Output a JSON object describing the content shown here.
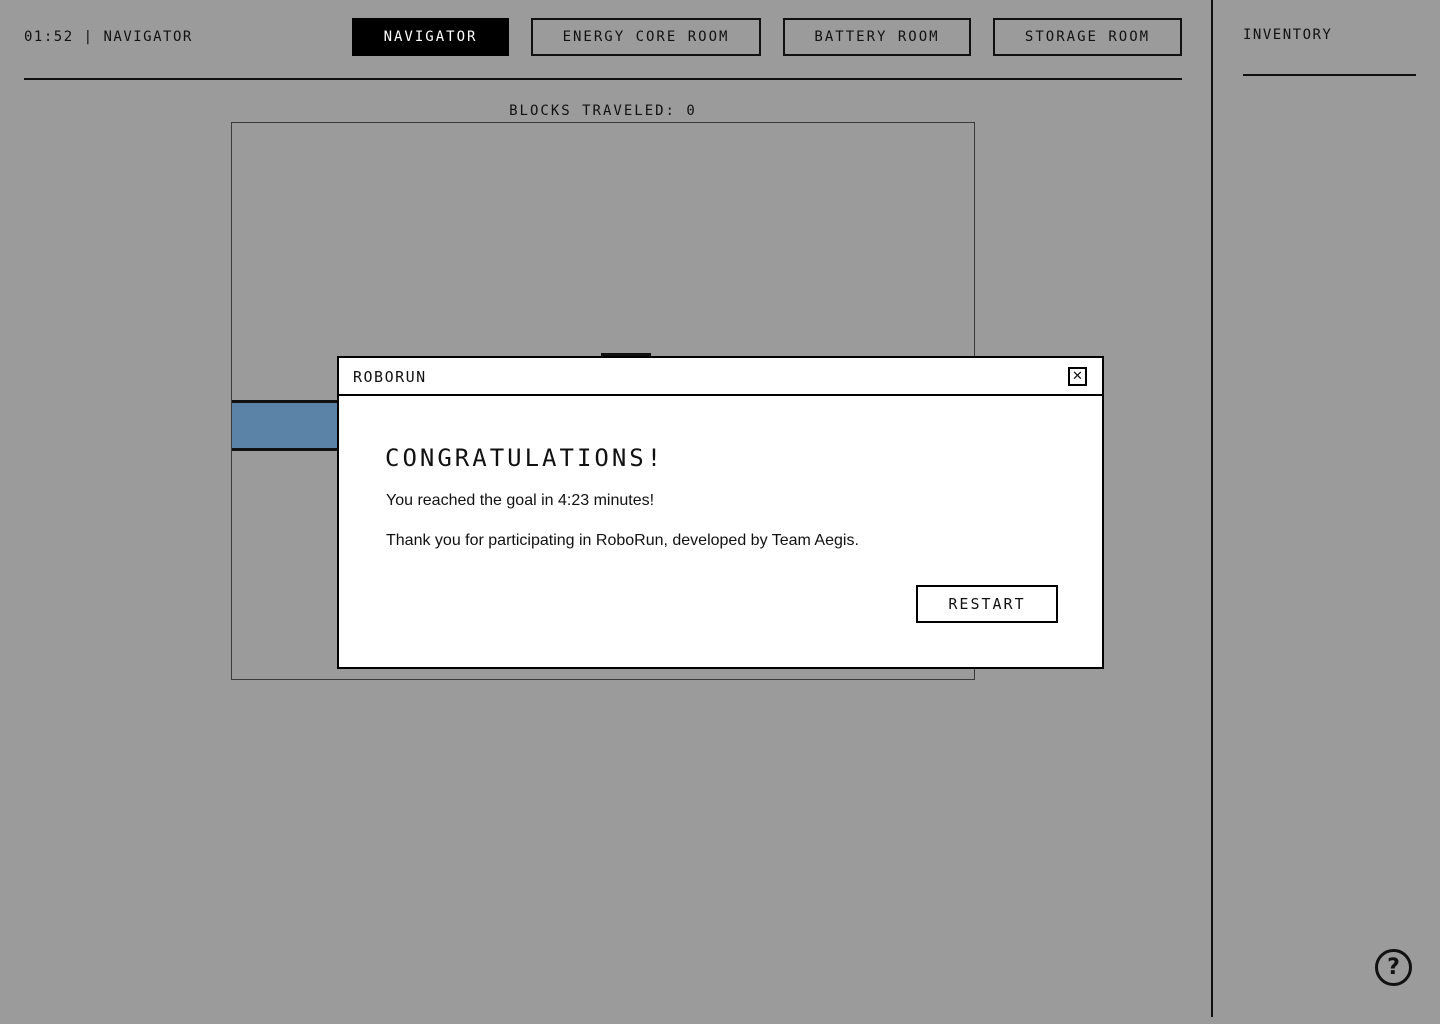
{
  "header": {
    "timer": "01:52",
    "separator": "|",
    "role": "NAVIGATOR",
    "tabs": [
      {
        "label": "NAVIGATOR",
        "active": true
      },
      {
        "label": "ENERGY CORE ROOM",
        "active": false
      },
      {
        "label": "BATTERY ROOM",
        "active": false
      },
      {
        "label": "STORAGE ROOM",
        "active": false
      }
    ]
  },
  "map": {
    "counter_label": "BLOCKS TRAVELED:",
    "blocks_traveled": "0"
  },
  "inventory": {
    "title": "INVENTORY"
  },
  "help": {
    "icon": "question-mark-icon",
    "glyph": "?"
  },
  "modal": {
    "title": "ROBORUN",
    "close_glyph": "✕",
    "heading": "CONGRATULATIONS!",
    "message": "You reached the goal in 4:23 minutes!",
    "thanks": "Thank you for participating in RoboRun, developed by Team Aegis.",
    "restart_label": "RESTART"
  },
  "colors": {
    "background": "#9b9b9b",
    "road": "#5b82a7",
    "active_tab": "#000000",
    "modal": "#ffffff"
  }
}
